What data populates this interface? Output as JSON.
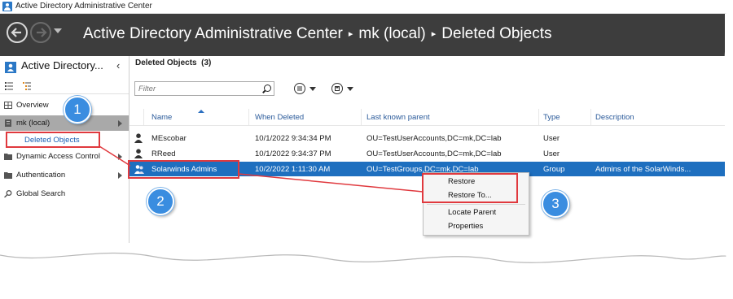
{
  "window": {
    "title": "Active Directory Administrative Center"
  },
  "header": {
    "breadcrumb": [
      "Active Directory Administrative Center",
      "mk (local)",
      "Deleted Objects"
    ]
  },
  "nav": {
    "title": "Active Directory...",
    "items": [
      {
        "label": "Overview",
        "icon": "overview-icon"
      },
      {
        "label": "mk (local)",
        "icon": "domain-icon",
        "expandable": true
      },
      {
        "label": "Deleted Objects"
      },
      {
        "label": "Dynamic Access Control",
        "icon": "folder-icon",
        "expandable": true
      },
      {
        "label": "Authentication",
        "icon": "folder-icon",
        "expandable": true
      },
      {
        "label": "Global Search",
        "icon": "search-icon"
      }
    ]
  },
  "main": {
    "title": "Deleted Objects",
    "count": "(3)",
    "filter_placeholder": "Filter",
    "columns": [
      "Name",
      "When Deleted",
      "Last known parent",
      "Type",
      "Description"
    ],
    "rows": [
      {
        "name": "MEscobar",
        "when_deleted": "10/1/2022 9:34:34 PM",
        "parent": "OU=TestUserAccounts,DC=mk,DC=lab",
        "type": "User",
        "description": ""
      },
      {
        "name": "RReed",
        "when_deleted": "10/1/2022 9:34:37 PM",
        "parent": "OU=TestUserAccounts,DC=mk,DC=lab",
        "type": "User",
        "description": ""
      },
      {
        "name": "Solarwinds Admins",
        "when_deleted": "10/2/2022 1:11:30 AM",
        "parent": "OU=TestGroups,DC=mk,DC=lab",
        "type": "Group",
        "description": "Admins of the SolarWinds..."
      }
    ]
  },
  "context_menu": {
    "items": [
      "Restore",
      "Restore To...",
      "Locate Parent",
      "Properties"
    ]
  },
  "annotations": {
    "badges": [
      "1",
      "2",
      "3"
    ]
  },
  "colors": {
    "header_bg": "#3d3d3d",
    "selection": "#1e6fbf",
    "annotation_red": "#e0393e",
    "badge_blue": "#3a8de0"
  }
}
